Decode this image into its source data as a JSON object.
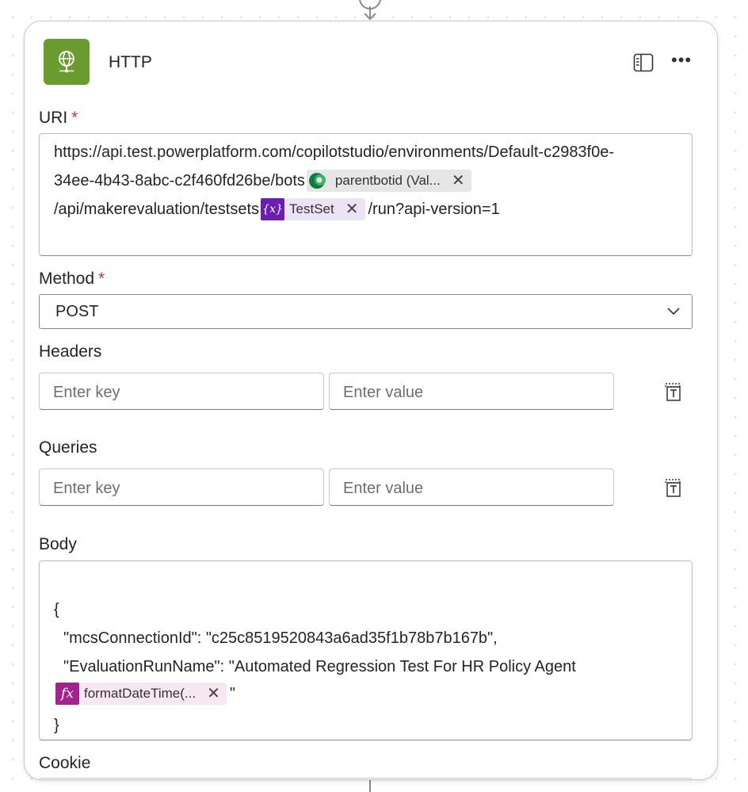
{
  "card": {
    "title": "HTTP",
    "icon": "globe-icon",
    "accent": "#6a9b2f"
  },
  "uri": {
    "label": "URI",
    "required_mark": "*",
    "line1": "https://api.test.powerplatform.com/copilotstudio/environments/Default-c2983f0e-",
    "line2_prefix": "34ee-4b43-8abc-c2f460fd26be/bots",
    "token1": {
      "label": "parentbotid (Val...",
      "icon": "dataverse-icon"
    },
    "line3_prefix": "/api/makerevaluation/testsets",
    "token2": {
      "label": "TestSet",
      "icon": "variable-icon",
      "icon_text": "{x}"
    },
    "line3_suffix": "/run?api-version=1"
  },
  "method": {
    "label": "Method",
    "required_mark": "*",
    "value": "POST"
  },
  "headers": {
    "label": "Headers",
    "key_placeholder": "Enter key",
    "value_placeholder": "Enter value"
  },
  "queries": {
    "label": "Queries",
    "key_placeholder": "Enter key",
    "value_placeholder": "Enter value"
  },
  "body": {
    "label": "Body",
    "open_brace": "{",
    "line1": "\"mcsConnectionId\": \"c25c8519520843a6ad35f1b78b7b167b\",",
    "line2": "\"EvaluationRunName\": \"Automated Regression Test For HR Policy Agent",
    "token": {
      "label": "formatDateTime(...",
      "icon": "function-icon",
      "icon_text": "fx"
    },
    "after_token": "\"",
    "close_brace": "}"
  },
  "cookie": {
    "label": "Cookie"
  },
  "token_remove_symbol": "✕"
}
